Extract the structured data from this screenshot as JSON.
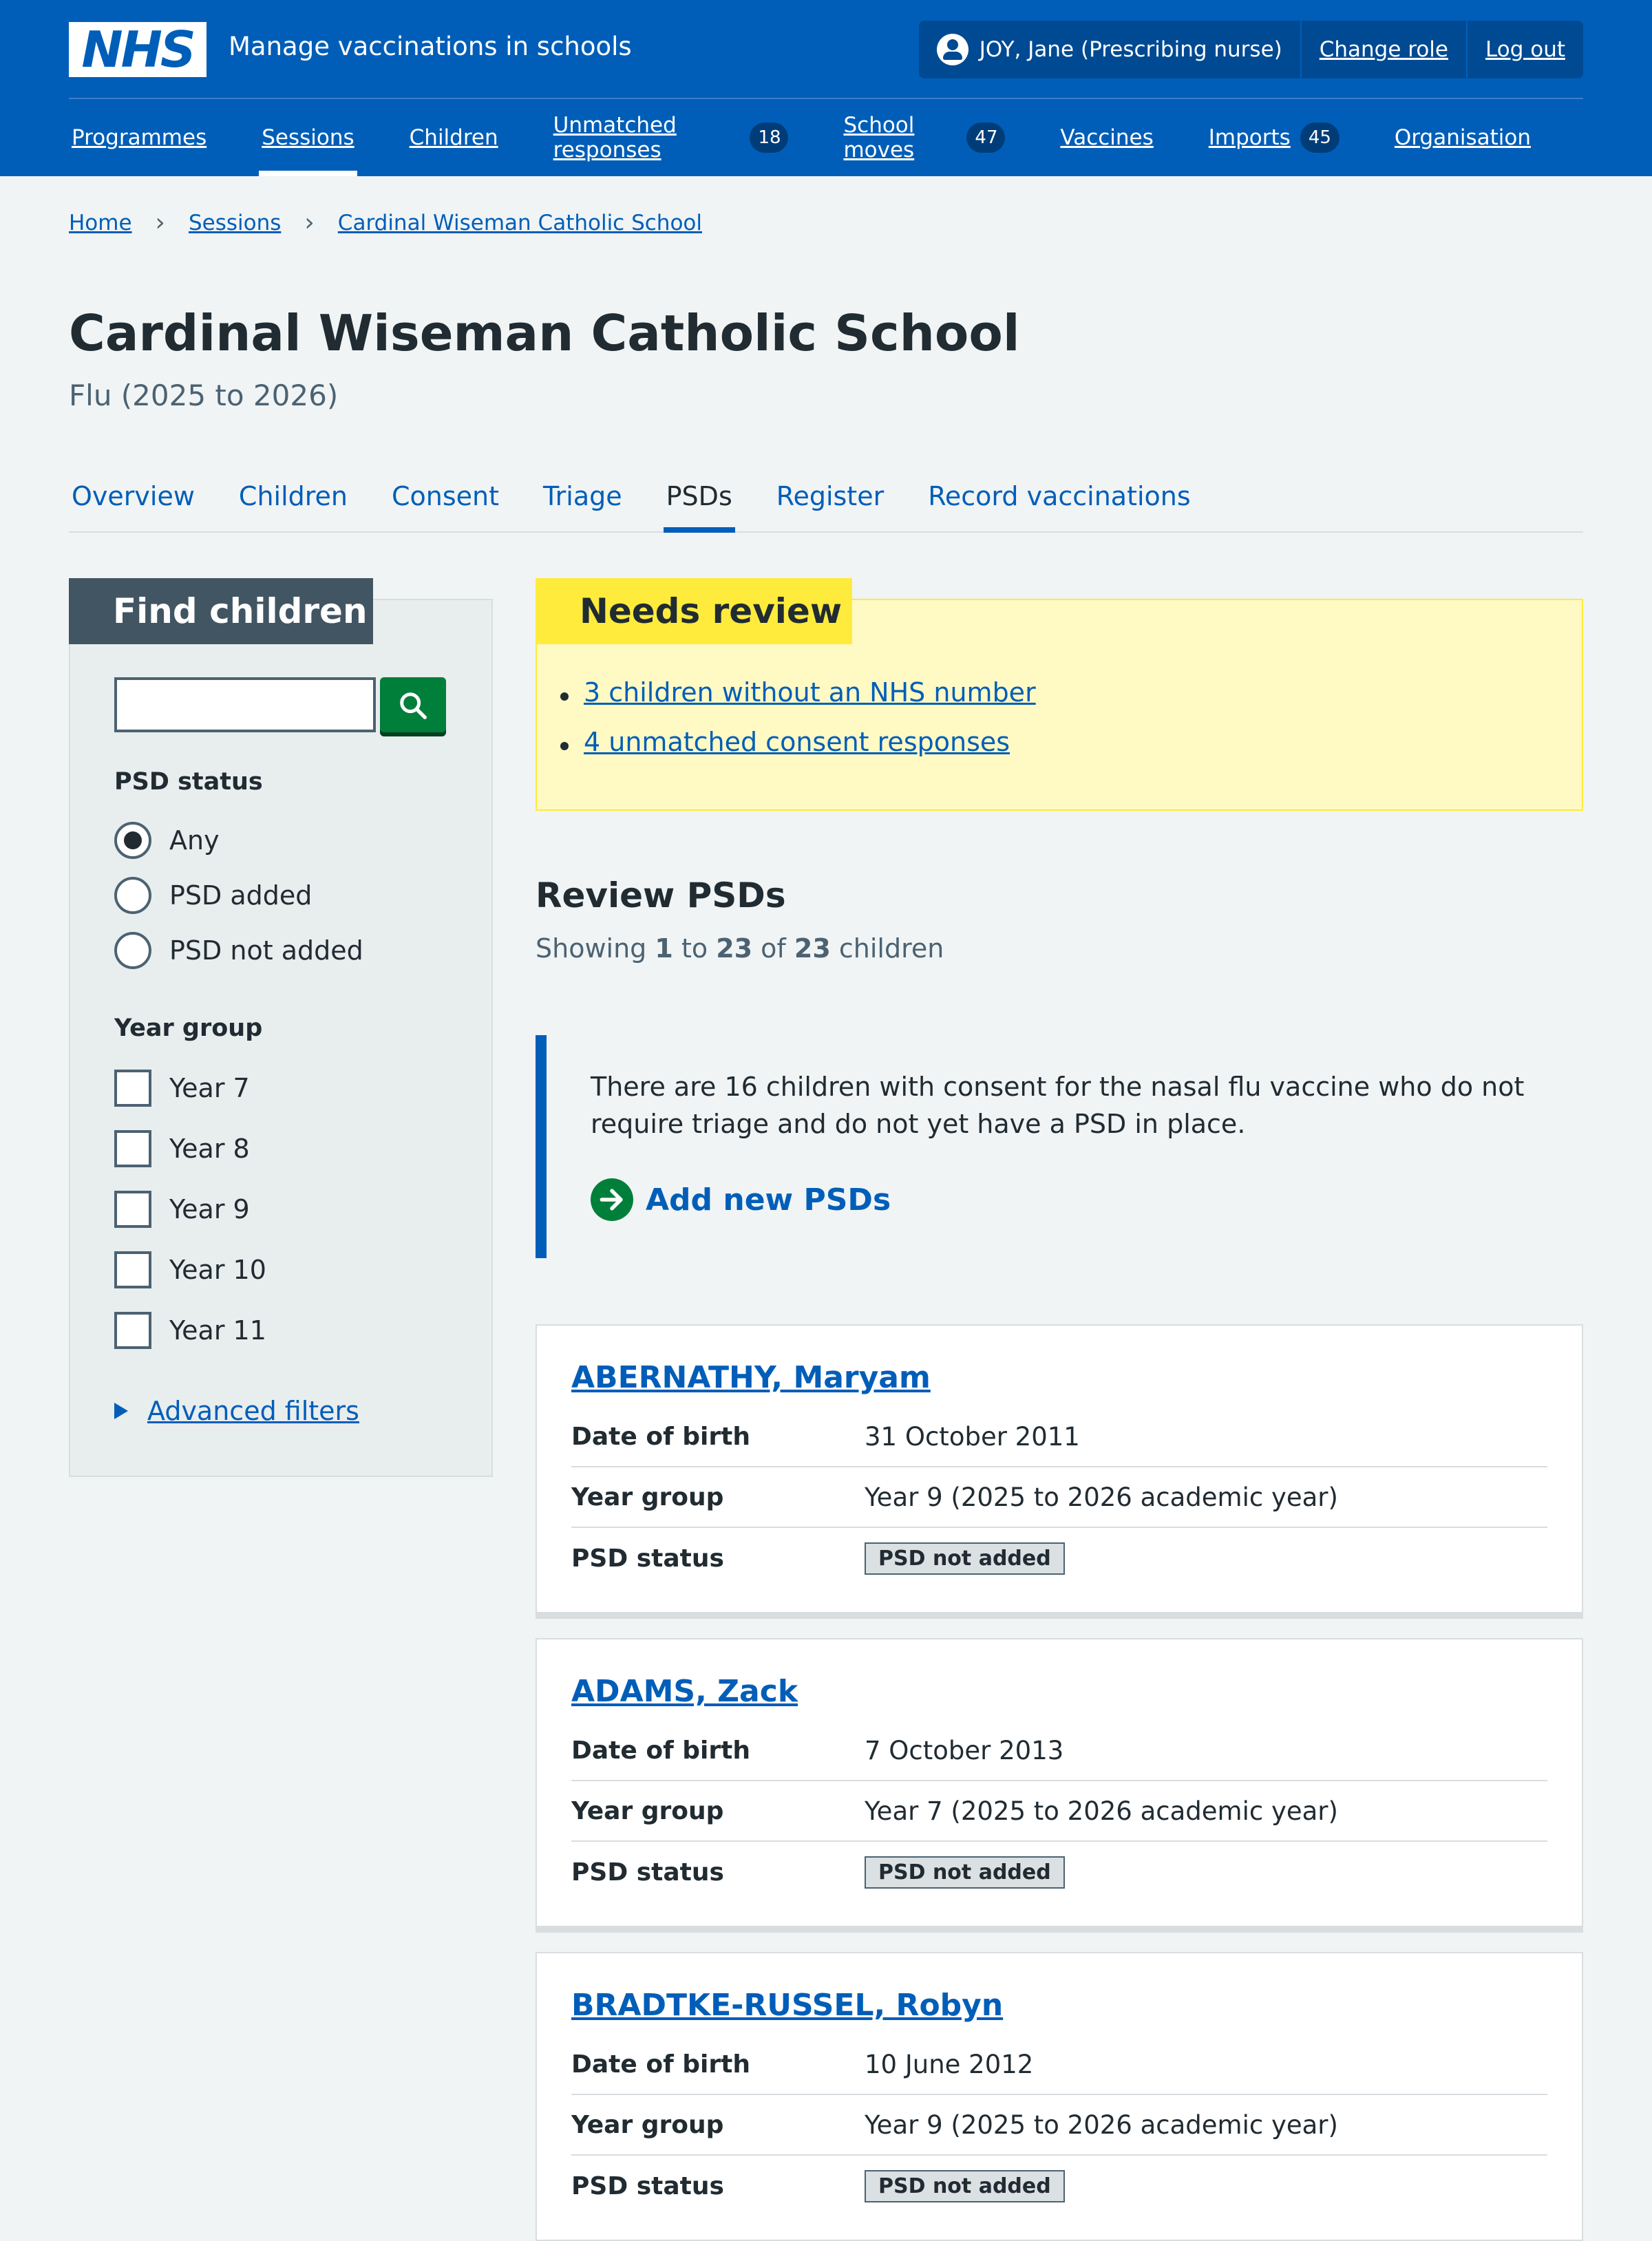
{
  "header": {
    "logo": "NHS",
    "service_name": "Manage vaccinations in schools",
    "user": "JOY, Jane (Prescribing nurse)",
    "change_role": "Change role",
    "log_out": "Log out"
  },
  "nav": [
    {
      "label": "Programmes",
      "count": null
    },
    {
      "label": "Sessions",
      "count": null
    },
    {
      "label": "Children",
      "count": null
    },
    {
      "label": "Unmatched responses",
      "count": "18"
    },
    {
      "label": "School moves",
      "count": "47"
    },
    {
      "label": "Vaccines",
      "count": null
    },
    {
      "label": "Imports",
      "count": "45"
    },
    {
      "label": "Organisation",
      "count": null
    }
  ],
  "breadcrumb": [
    "Home",
    "Sessions",
    "Cardinal Wiseman Catholic School"
  ],
  "page": {
    "title": "Cardinal Wiseman Catholic School",
    "caption": "Flu (2025 to 2026)"
  },
  "tabs": [
    "Overview",
    "Children",
    "Consent",
    "Triage",
    "PSDs",
    "Register",
    "Record vaccinations"
  ],
  "filter": {
    "heading": "Find children",
    "search_value": "",
    "psd_status_title": "PSD status",
    "psd_options": [
      "Any",
      "PSD added",
      "PSD not added"
    ],
    "psd_selected": "Any",
    "year_group_title": "Year group",
    "year_options": [
      "Year 7",
      "Year 8",
      "Year 9",
      "Year 10",
      "Year 11"
    ],
    "advanced": "Advanced filters"
  },
  "needs_review": {
    "heading": "Needs review",
    "items": [
      "3 children without an NHS number",
      "4 unmatched consent responses"
    ]
  },
  "review_psds": {
    "title": "Review PSDs",
    "showing_prefix": "Showing",
    "from": "1",
    "to_word": "to",
    "to": "23",
    "of_word": "of",
    "total": "23",
    "suffix": "children"
  },
  "inset": {
    "text": "There are 16 children with consent for the nasal flu vaccine who do not require triage and do not yet have a PSD in place.",
    "action": "Add new PSDs"
  },
  "cards": [
    {
      "name": "ABERNATHY, Maryam",
      "dob": "31 October 2011",
      "year_group": "Year 9 (2025 to 2026 academic year)",
      "status": "PSD not added"
    },
    {
      "name": "ADAMS, Zack",
      "dob": "7 October 2013",
      "year_group": "Year 7 (2025 to 2026 academic year)",
      "status": "PSD not added"
    },
    {
      "name": "BRADTKE-RUSSEL, Robyn",
      "dob": "10 June 2012",
      "year_group": "Year 9 (2025 to 2026 academic year)",
      "status": "PSD not added"
    }
  ],
  "card_labels": {
    "dob": "Date of birth",
    "year_group": "Year group",
    "status": "PSD status"
  },
  "colors": {
    "nhs_blue": "#005eb8",
    "header_dark": "#004a93",
    "green": "#007f3b",
    "warning_yellow": "#ffeb3b",
    "warning_bg": "#fff9c4"
  }
}
